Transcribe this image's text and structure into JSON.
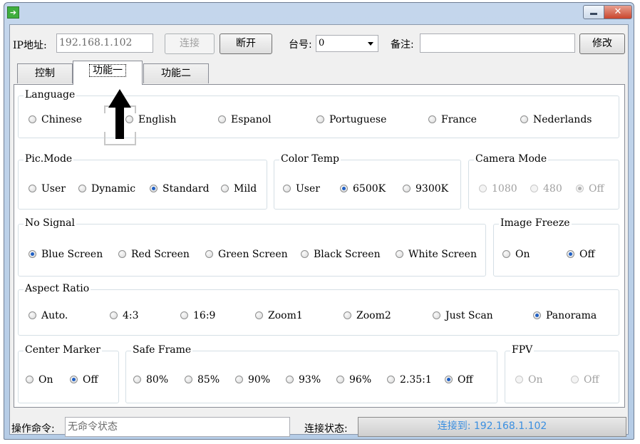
{
  "titlebar": {
    "app_icon": "arrow-icon",
    "minimize_icon": "minimize-icon",
    "close_icon": "close-icon",
    "close_glyph": "✕"
  },
  "toolbar": {
    "ip_label": "IP地址:",
    "ip_value": "192.168.1.102",
    "connect_label": "连接",
    "disconnect_label": "断开",
    "unit_label": "台号:",
    "unit_value": "0",
    "note_label": "备注:",
    "note_value": "",
    "modify_label": "修改"
  },
  "tabs": [
    {
      "label": "控制",
      "selected": false
    },
    {
      "label": "功能一",
      "selected": true
    },
    {
      "label": "功能二",
      "selected": false
    }
  ],
  "groups": {
    "language": {
      "label": "Language",
      "options": [
        "Chinese",
        "English",
        "Espanol",
        "Portuguese",
        "France",
        "Nederlands"
      ],
      "selected": null
    },
    "pic_mode": {
      "label": "Pic.Mode",
      "options": [
        "User",
        "Dynamic",
        "Standard",
        "Mild"
      ],
      "selected": "Standard"
    },
    "color_temp": {
      "label": "Color Temp",
      "options": [
        "User",
        "6500K",
        "9300K"
      ],
      "selected": "6500K"
    },
    "camera_mode": {
      "label": "Camera Mode",
      "options": [
        "1080",
        "480",
        "Off"
      ],
      "selected": "Off",
      "enabled": false
    },
    "no_signal": {
      "label": "No Signal",
      "options": [
        "Blue Screen",
        "Red Screen",
        "Green Screen",
        "Black Screen",
        "White Screen"
      ],
      "selected": "Blue Screen"
    },
    "image_freeze": {
      "label": "Image Freeze",
      "options": [
        "On",
        "Off"
      ],
      "selected": "Off"
    },
    "aspect_ratio": {
      "label": "Aspect Ratio",
      "options": [
        "Auto.",
        "4:3",
        "16:9",
        "Zoom1",
        "Zoom2",
        "Just Scan",
        "Panorama"
      ],
      "selected": "Panorama"
    },
    "center_marker": {
      "label": "Center Marker",
      "options": [
        "On",
        "Off"
      ],
      "selected": "Off"
    },
    "safe_frame": {
      "label": "Safe Frame",
      "options": [
        "80%",
        "85%",
        "90%",
        "93%",
        "96%",
        "2.35:1",
        "Off"
      ],
      "selected": "Off"
    },
    "fpv": {
      "label": "FPV",
      "options": [
        "On",
        "Off"
      ],
      "selected": null,
      "enabled": false
    }
  },
  "statusbar": {
    "command_label": "操作命令:",
    "command_value": "无命令状态",
    "connection_label": "连接状态:",
    "connection_value": "连接到: 192.168.1.102"
  },
  "colors": {
    "accent": "#1f5fc4",
    "status_text": "#3b8fe0",
    "titlebar": "#c4d6ec"
  }
}
